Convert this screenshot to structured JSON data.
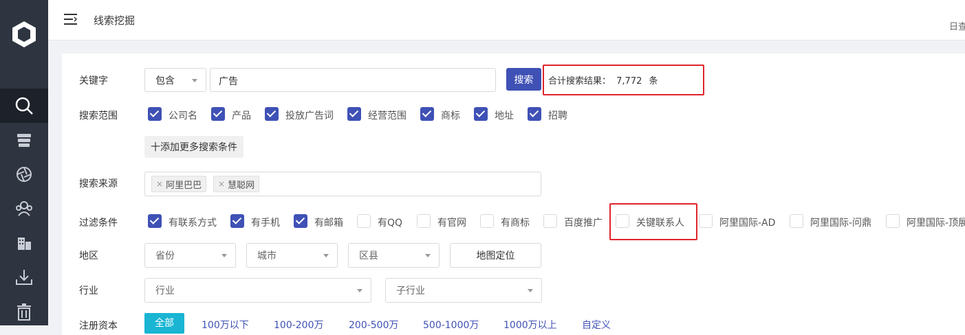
{
  "header": {
    "title": "线索挖掘",
    "right_text": "日查"
  },
  "sidebar": {
    "items": [
      {
        "name": "search",
        "active": true
      },
      {
        "name": "database",
        "active": false
      },
      {
        "name": "aperture",
        "active": false
      },
      {
        "name": "users",
        "active": false
      },
      {
        "name": "building",
        "active": false
      },
      {
        "name": "download",
        "active": false
      },
      {
        "name": "trash",
        "active": false
      }
    ]
  },
  "keyword": {
    "label": "关键字",
    "mode": "包含",
    "value": "广告",
    "search_button": "搜索",
    "result_prefix": "合计搜索结果：",
    "result_count": "7,772",
    "result_suffix": "条"
  },
  "scope": {
    "label": "搜索范围",
    "options": [
      {
        "label": "公司名",
        "checked": true
      },
      {
        "label": "产品",
        "checked": true
      },
      {
        "label": "投放广告词",
        "checked": true
      },
      {
        "label": "经营范围",
        "checked": true
      },
      {
        "label": "商标",
        "checked": true
      },
      {
        "label": "地址",
        "checked": true
      },
      {
        "label": "招聘",
        "checked": true
      }
    ],
    "add_more": "十添加更多搜索条件"
  },
  "source": {
    "label": "搜索来源",
    "tags": [
      "阿里巴巴",
      "慧聪网"
    ]
  },
  "filter": {
    "label": "过滤条件",
    "options": [
      {
        "label": "有联系方式",
        "checked": true
      },
      {
        "label": "有手机",
        "checked": true
      },
      {
        "label": "有邮箱",
        "checked": true
      },
      {
        "label": "有QQ",
        "checked": false
      },
      {
        "label": "有官网",
        "checked": false
      },
      {
        "label": "有商标",
        "checked": false
      },
      {
        "label": "百度推广",
        "checked": false
      },
      {
        "label": "关键联系人",
        "checked": false
      },
      {
        "label": "阿里国际-AD",
        "checked": false
      },
      {
        "label": "阿里国际-问鼎",
        "checked": false
      },
      {
        "label": "阿里国际-顶展",
        "checked": false
      }
    ]
  },
  "region": {
    "label": "地区",
    "province": "省份",
    "city": "城市",
    "county": "区县",
    "map_button": "地图定位"
  },
  "industry": {
    "label": "行业",
    "industry": "行业",
    "sub_industry": "子行业"
  },
  "capital": {
    "label": "注册资本",
    "options": [
      "全部",
      "100万以下",
      "100-200万",
      "200-500万",
      "500-1000万",
      "1000万以上",
      "自定义"
    ]
  },
  "colors": {
    "primary": "#3f51b5",
    "sidebar": "#2e3440",
    "highlight": "#e0232b",
    "selected": "#19b5d3"
  }
}
